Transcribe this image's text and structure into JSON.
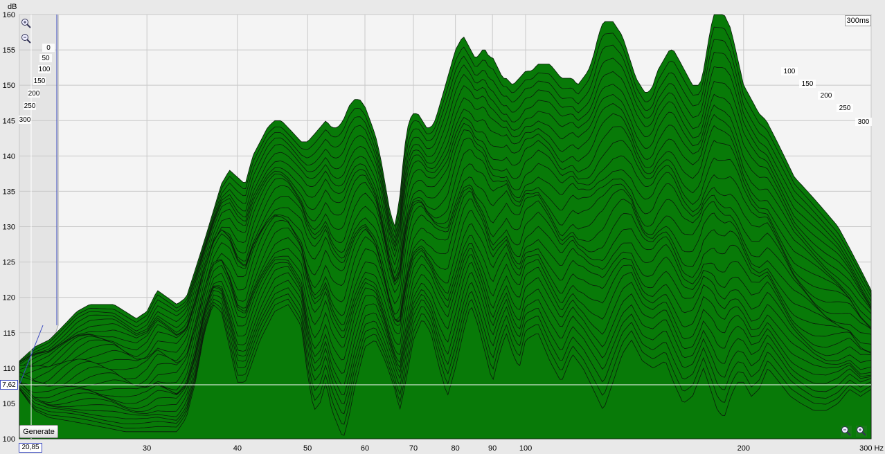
{
  "chart_data": {
    "type": "area",
    "title": "",
    "ylabel": "dB",
    "xunit": "Hz",
    "xscale": "log",
    "xlim": [
      20,
      300
    ],
    "ylim": [
      100,
      160
    ],
    "y_ticks": [
      "100",
      "105",
      "110",
      "115",
      "120",
      "125",
      "130",
      "135",
      "140",
      "145",
      "150",
      "155",
      "160"
    ],
    "x_ticks": [
      "30",
      "40",
      "50",
      "60",
      "70",
      "80",
      "90",
      "100",
      "200",
      "300 Hz"
    ],
    "time_ticks_left": [
      "0",
      "50",
      "100",
      "150",
      "200",
      "250",
      "300"
    ],
    "time_ticks_right": [
      "100",
      "150",
      "200",
      "250",
      "300"
    ],
    "time_range_label": "300ms",
    "fill_color": "#087a08",
    "grid": true,
    "cursor": {
      "x": "20,85",
      "y": "7,62"
    },
    "front_slice_dB": [
      [
        20,
        107
      ],
      [
        21,
        104
      ],
      [
        22,
        103
      ],
      [
        25,
        102
      ],
      [
        28,
        101
      ],
      [
        31,
        101
      ],
      [
        33,
        101
      ],
      [
        34,
        103
      ],
      [
        35,
        108
      ],
      [
        36,
        115
      ],
      [
        37,
        119
      ],
      [
        38,
        118
      ],
      [
        39,
        113
      ],
      [
        40,
        108
      ],
      [
        41,
        108
      ],
      [
        43,
        114
      ],
      [
        45,
        118
      ],
      [
        47,
        119
      ],
      [
        49,
        116
      ],
      [
        50,
        109
      ],
      [
        51,
        104
      ],
      [
        52,
        105
      ],
      [
        53,
        108
      ],
      [
        54,
        104
      ],
      [
        55,
        102
      ],
      [
        56,
        100
      ],
      [
        57,
        103
      ],
      [
        58,
        107
      ],
      [
        60,
        113
      ],
      [
        62,
        114
      ],
      [
        64,
        111
      ],
      [
        66,
        107
      ],
      [
        67,
        104
      ],
      [
        68,
        107
      ],
      [
        70,
        114
      ],
      [
        72,
        117
      ],
      [
        74,
        115
      ],
      [
        76,
        110
      ],
      [
        78,
        106
      ],
      [
        80,
        110
      ],
      [
        82,
        115
      ],
      [
        84,
        119
      ],
      [
        86,
        116
      ],
      [
        88,
        112
      ],
      [
        90,
        108
      ],
      [
        92,
        112
      ],
      [
        94,
        115
      ],
      [
        96,
        112
      ],
      [
        98,
        110
      ],
      [
        100,
        114
      ],
      [
        104,
        115
      ],
      [
        108,
        111
      ],
      [
        112,
        108
      ],
      [
        116,
        112
      ],
      [
        120,
        110
      ],
      [
        124,
        107
      ],
      [
        128,
        104
      ],
      [
        132,
        108
      ],
      [
        136,
        112
      ],
      [
        140,
        114
      ],
      [
        145,
        111
      ],
      [
        150,
        110
      ],
      [
        156,
        111
      ],
      [
        160,
        108
      ],
      [
        165,
        105
      ],
      [
        170,
        106
      ],
      [
        176,
        110
      ],
      [
        180,
        107
      ],
      [
        184,
        104
      ],
      [
        188,
        103
      ],
      [
        192,
        106
      ],
      [
        196,
        108
      ],
      [
        200,
        108
      ],
      [
        205,
        106
      ],
      [
        210,
        107
      ],
      [
        216,
        110
      ],
      [
        224,
        108
      ],
      [
        232,
        106
      ],
      [
        240,
        105
      ],
      [
        250,
        104
      ],
      [
        260,
        104
      ],
      [
        270,
        105
      ],
      [
        280,
        107
      ],
      [
        290,
        106
      ],
      [
        300,
        107
      ]
    ],
    "rear_slice_dB": [
      [
        20,
        111
      ],
      [
        21,
        113
      ],
      [
        22,
        114
      ],
      [
        23,
        116
      ],
      [
        24,
        118
      ],
      [
        25,
        119
      ],
      [
        26,
        119
      ],
      [
        27,
        119
      ],
      [
        28,
        118
      ],
      [
        29,
        117
      ],
      [
        30,
        118
      ],
      [
        31,
        121
      ],
      [
        32,
        120
      ],
      [
        33,
        119
      ],
      [
        34,
        120
      ],
      [
        35,
        124
      ],
      [
        36,
        128
      ],
      [
        37,
        132
      ],
      [
        38,
        136
      ],
      [
        39,
        138
      ],
      [
        40,
        137
      ],
      [
        41,
        136
      ],
      [
        42,
        140
      ],
      [
        43,
        142
      ],
      [
        44,
        144
      ],
      [
        45,
        145
      ],
      [
        46,
        145
      ],
      [
        47,
        144
      ],
      [
        48,
        143
      ],
      [
        49,
        142
      ],
      [
        50,
        142
      ],
      [
        51,
        143
      ],
      [
        52,
        144
      ],
      [
        53,
        145
      ],
      [
        54,
        144
      ],
      [
        55,
        144
      ],
      [
        56,
        145
      ],
      [
        57,
        147
      ],
      [
        58,
        148
      ],
      [
        59,
        148
      ],
      [
        60,
        147
      ],
      [
        61,
        145
      ],
      [
        62,
        143
      ],
      [
        63,
        140
      ],
      [
        64,
        136
      ],
      [
        65,
        132
      ],
      [
        66,
        130
      ],
      [
        67,
        134
      ],
      [
        68,
        141
      ],
      [
        69,
        145
      ],
      [
        70,
        146
      ],
      [
        71,
        146
      ],
      [
        72,
        145
      ],
      [
        73,
        144
      ],
      [
        74,
        144
      ],
      [
        75,
        145
      ],
      [
        76,
        147
      ],
      [
        77,
        149
      ],
      [
        78,
        151
      ],
      [
        79,
        153
      ],
      [
        80,
        155
      ],
      [
        81,
        156
      ],
      [
        82,
        157
      ],
      [
        83,
        156
      ],
      [
        84,
        155
      ],
      [
        85,
        154
      ],
      [
        86,
        154
      ],
      [
        87,
        155
      ],
      [
        88,
        155
      ],
      [
        89,
        154
      ],
      [
        90,
        154
      ],
      [
        91,
        153
      ],
      [
        92,
        152
      ],
      [
        93,
        151
      ],
      [
        94,
        151
      ],
      [
        96,
        150
      ],
      [
        98,
        151
      ],
      [
        100,
        152
      ],
      [
        102,
        152
      ],
      [
        104,
        153
      ],
      [
        106,
        153
      ],
      [
        108,
        153
      ],
      [
        110,
        152
      ],
      [
        112,
        151
      ],
      [
        114,
        151
      ],
      [
        116,
        151
      ],
      [
        118,
        150
      ],
      [
        120,
        151
      ],
      [
        122,
        152
      ],
      [
        124,
        154
      ],
      [
        126,
        157
      ],
      [
        128,
        159
      ],
      [
        130,
        159
      ],
      [
        132,
        159
      ],
      [
        134,
        158
      ],
      [
        136,
        157
      ],
      [
        138,
        155
      ],
      [
        140,
        153
      ],
      [
        142,
        151
      ],
      [
        144,
        150
      ],
      [
        146,
        149
      ],
      [
        148,
        149
      ],
      [
        150,
        150
      ],
      [
        152,
        152
      ],
      [
        154,
        153
      ],
      [
        156,
        154
      ],
      [
        158,
        155
      ],
      [
        160,
        155
      ],
      [
        162,
        154
      ],
      [
        164,
        153
      ],
      [
        166,
        152
      ],
      [
        168,
        151
      ],
      [
        170,
        150
      ],
      [
        172,
        150
      ],
      [
        174,
        150
      ],
      [
        176,
        152
      ],
      [
        178,
        155
      ],
      [
        180,
        158
      ],
      [
        182,
        160
      ],
      [
        184,
        160
      ],
      [
        186,
        160
      ],
      [
        188,
        160
      ],
      [
        190,
        159
      ],
      [
        192,
        158
      ],
      [
        194,
        156
      ],
      [
        196,
        154
      ],
      [
        198,
        152
      ],
      [
        200,
        150
      ],
      [
        205,
        148
      ],
      [
        210,
        146
      ],
      [
        215,
        145
      ],
      [
        220,
        143
      ],
      [
        225,
        141
      ],
      [
        230,
        139
      ],
      [
        235,
        137
      ],
      [
        240,
        136
      ],
      [
        245,
        135
      ],
      [
        250,
        134
      ],
      [
        260,
        132
      ],
      [
        270,
        130
      ],
      [
        280,
        127
      ],
      [
        290,
        124
      ],
      [
        300,
        121
      ]
    ]
  },
  "controls": {
    "generate_label": "Generate"
  }
}
